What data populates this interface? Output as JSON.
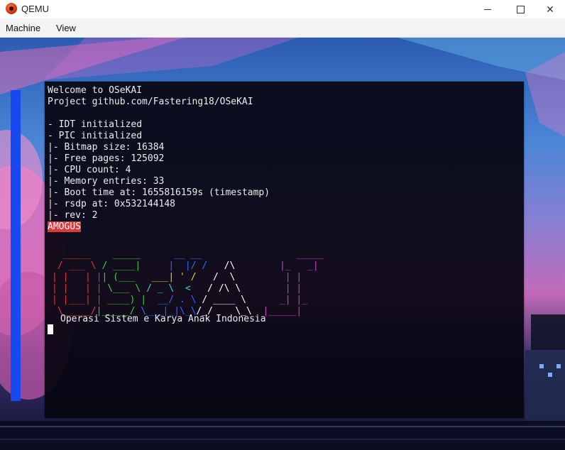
{
  "window": {
    "title": "QEMU",
    "icon": "qemu-icon",
    "minimize_label": "",
    "maximize_label": "",
    "close_label": "✕"
  },
  "menubar": {
    "items": [
      {
        "label": "Machine"
      },
      {
        "label": "View"
      }
    ]
  },
  "terminal": {
    "lines": [
      "Welcome to OSeKAI",
      "Project github.com/Fastering18/OSeKAI",
      "",
      "- IDT initialized",
      "- PIC initialized",
      "|- Bitmap size: 16384",
      "|- Free pages: 125092",
      "|- CPU count: 4",
      "|- Memory entries: 33",
      "|- Boot time at: 1655816159s (timestamp)",
      "|- rsdp at: 0x532144148",
      "|- rev: 2"
    ],
    "highlight_line": "AMOGUS",
    "highlight_color": "#e0373a",
    "ascii_logo_rows": [
      [
        {
          "t": "  _____  ",
          "c": "#e0373a"
        },
        {
          "t": "  _____  ",
          "c": "#37d13d"
        },
        {
          "t": "    __ __",
          "c": "#2f6bff"
        },
        {
          "t": "        ",
          "c": "#ffffff"
        },
        {
          "t": "       ",
          "c": "#ffffff"
        },
        {
          "t": "  _____",
          "c": "#d03bd0"
        }
      ],
      [
        {
          "t": " / ___ \\ ",
          "c": "#e0373a"
        },
        {
          "t": "/ ____|  ",
          "c": "#37d13d"
        },
        {
          "t": "   |  |/ /",
          "c": "#2f6bff"
        },
        {
          "t": "   /\\  ",
          "c": "#ffffff"
        },
        {
          "t": "     ",
          "c": "#ffffff"
        },
        {
          "t": " |_   _|",
          "c": "#d03bd0"
        }
      ],
      [
        {
          "t": "| |   | |",
          "c": "#e0373a"
        },
        {
          "t": "| (___   ",
          "c": "#37d13d"
        },
        {
          "t": "___| ' / ",
          "c": "#d8d83a"
        },
        {
          "t": "  /  \\  ",
          "c": "#ffffff"
        },
        {
          "t": "     ",
          "c": "#ffffff"
        },
        {
          "t": "  | |",
          "c": "#d03bd0"
        }
      ],
      [
        {
          "t": "| |   | |",
          "c": "#e0373a"
        },
        {
          "t": " \\___ \\ ",
          "c": "#37d13d"
        },
        {
          "t": "/ _ \\  <  ",
          "c": "#3cd3d3"
        },
        {
          "t": " / /\\ \\ ",
          "c": "#ffffff"
        },
        {
          "t": "     ",
          "c": "#ffffff"
        },
        {
          "t": "  | |",
          "c": "#d03bd0"
        }
      ],
      [
        {
          "t": "| |___| |",
          "c": "#e0373a"
        },
        {
          "t": " ____) |",
          "c": "#37d13d"
        },
        {
          "t": "  __/ . \\ ",
          "c": "#2f6bff"
        },
        {
          "t": "/ ____ \\ ",
          "c": "#ffffff"
        },
        {
          "t": "    ",
          "c": "#ffffff"
        },
        {
          "t": " _| |_",
          "c": "#d03bd0"
        }
      ],
      [
        {
          "t": " \\_____/",
          "c": "#e0373a"
        },
        {
          "t": "|_____/ ",
          "c": "#37d13d"
        },
        {
          "t": "\\___|_|\\_\\",
          "c": "#2f6bff"
        },
        {
          "t": "/_/    \\_\\",
          "c": "#ffffff"
        },
        {
          "t": "  ",
          "c": "#ffffff"
        },
        {
          "t": "|_____|",
          "c": "#d03bd0"
        }
      ]
    ],
    "tagline": "Operasi Sistem e Karya Anak Indonesia"
  },
  "colors": {
    "sidebar_accent": "#1849f0",
    "terminal_bg": "#060510",
    "terminal_fg": "#ededed"
  }
}
